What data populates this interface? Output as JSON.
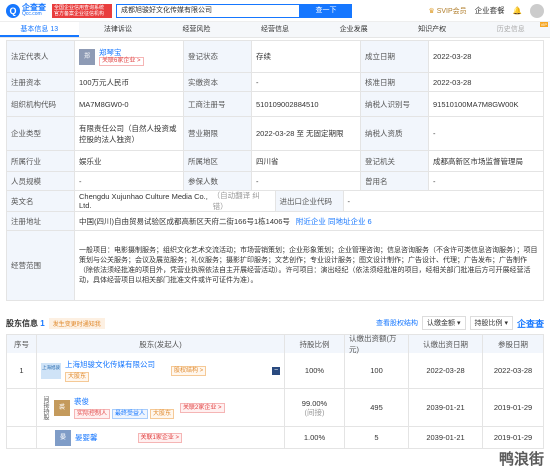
{
  "header": {
    "logo_name": "企查查",
    "logo_domain": "Qcc.com",
    "badge": "全国企业信用查询系统 官方备案企业征信机构",
    "search_value": "成都旭骏好文化传媒有限公司",
    "search_button": "查一下",
    "svip": "SVIP会员",
    "enterprise": "企业套餐"
  },
  "tabs": [
    {
      "label": "基本信息",
      "count": "13"
    },
    {
      "label": "法律诉讼"
    },
    {
      "label": "经营风险"
    },
    {
      "label": "经营信息"
    },
    {
      "label": "企业发展"
    },
    {
      "label": "知识产权"
    },
    {
      "label": "历史信息",
      "tag": "VIP"
    }
  ],
  "info": {
    "legal_rep_label": "法定代表人",
    "legal_rep_avatar": "郑",
    "legal_rep_name": "郑琴宝",
    "legal_rep_tag": "关联6家企业 >",
    "reg_status_label": "登记状态",
    "reg_status": "存续",
    "est_date_label": "成立日期",
    "est_date": "2022-03-28",
    "reg_capital_label": "注册资本",
    "reg_capital": "100万元人民币",
    "paid_capital_label": "实缴资本",
    "paid_capital": "-",
    "approve_date_label": "核准日期",
    "approve_date": "2022-03-28",
    "org_code_label": "组织机构代码",
    "org_code": "MA7M8GW0-0",
    "biz_reg_no_label": "工商注册号",
    "biz_reg_no": "510109002884510",
    "taxpayer_no_label": "纳税人识别号",
    "taxpayer_no": "91510100MA7M8GW00K",
    "type_label": "企业类型",
    "type": "有限责任公司（自然人投资或控股的法人独资）",
    "term_label": "营业期限",
    "term": "2022-03-28 至 无固定期限",
    "taxpayer_q_label": "纳税人资质",
    "taxpayer_q": "-",
    "industry_label": "所属行业",
    "industry": "娱乐业",
    "region_label": "所属地区",
    "region": "四川省",
    "reg_authority_label": "登记机关",
    "reg_authority": "成都高新区市场监督管理局",
    "staff_label": "人员规模",
    "staff": "-",
    "insured_label": "参保人数",
    "insured": "-",
    "former_name_label": "曾用名",
    "former_name": "-",
    "en_name_label": "英文名",
    "en_name": "Chengdu Xujunhao Culture Media Co., Ltd.",
    "en_name_note": "（自动翻译 纠错）",
    "import_export_label": "进出口企业代码",
    "import_export": "-",
    "address_label": "注册地址",
    "address": "中国(四川)自由贸易试验区成都高新区天府二街166号1栋1406号",
    "address_links": "附近企业   同地址企业 6",
    "scope_label": "经营范围",
    "scope": "一般项目：电影摄制服务；组织文化艺术交流活动；市场营销策划；企业形象策划；企业管理咨询；信息咨询服务（不含许可类信息咨询服务）；项目策划与公关服务；会议及展览服务；礼仪服务；摄影扩印服务；文艺创作；专业设计服务；图文设计制作；广告设计、代理；广告发布；广告制作（除依法须经批准的项目外，凭营业执照依法自主开展经营活动）。许可项目：演出经纪（依法须经批准的项目，经相关部门批准后方可开展经营活动，具体经营项目以相关部门批准文件或许可证件为准）。"
  },
  "shareholders": {
    "title": "股东信息",
    "count": "1",
    "notice": "发生变更时通知我",
    "equity_link": "查看股权结构",
    "sort1": "认缴金额",
    "sort2": "持股比例",
    "columns": [
      "序号",
      "股东(发起人)",
      "持股比例",
      "认缴出资额(万元)",
      "认缴出资日期",
      "参股日期"
    ],
    "rows": [
      {
        "index": "1",
        "logo": "上海旭骏",
        "name": "上海旭骏文化传媒有限公司",
        "tag": "大股东",
        "link": "股权结构 >",
        "ratio": "100%",
        "amount": "100",
        "sub_date": "2022-03-28",
        "join_date": "2022-03-28"
      }
    ],
    "sub": [
      {
        "label": "间接持股",
        "avatar": "裘",
        "name": "裘俊",
        "tags": [
          "实际控制人",
          "最终受益人",
          "大股东"
        ],
        "link": "关联2家企业 >",
        "ratio": "99.00%",
        "ratio2": "(间接)",
        "amount": "495",
        "sub_date": "2039-01-21",
        "join_date": "2019-01-29"
      },
      {
        "avatar": "晏",
        "name": "晏婴馨",
        "link": "关联1家企业 >",
        "ratio": "1.00%",
        "amount": "5",
        "sub_date": "2039-01-21",
        "join_date": "2019-01-29"
      }
    ]
  },
  "watermark": "鸭浪街"
}
